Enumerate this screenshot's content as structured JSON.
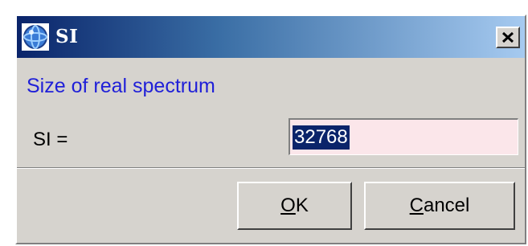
{
  "window": {
    "title": "SI",
    "icon": "bruker-logo-icon",
    "close_icon": "close-icon"
  },
  "header": {
    "label": "Size of real spectrum"
  },
  "parameter": {
    "label": "SI =",
    "value": "32768"
  },
  "buttons": {
    "ok": {
      "mnemonic": "O",
      "rest": "K"
    },
    "cancel": {
      "mnemonic": "C",
      "rest": "ancel"
    }
  },
  "colors": {
    "titlebar_start": "#0a246a",
    "titlebar_end": "#a6caf0",
    "header_text": "#2020d8",
    "field_bg": "#fbe6ea",
    "dialog_bg": "#d6d3ce"
  }
}
